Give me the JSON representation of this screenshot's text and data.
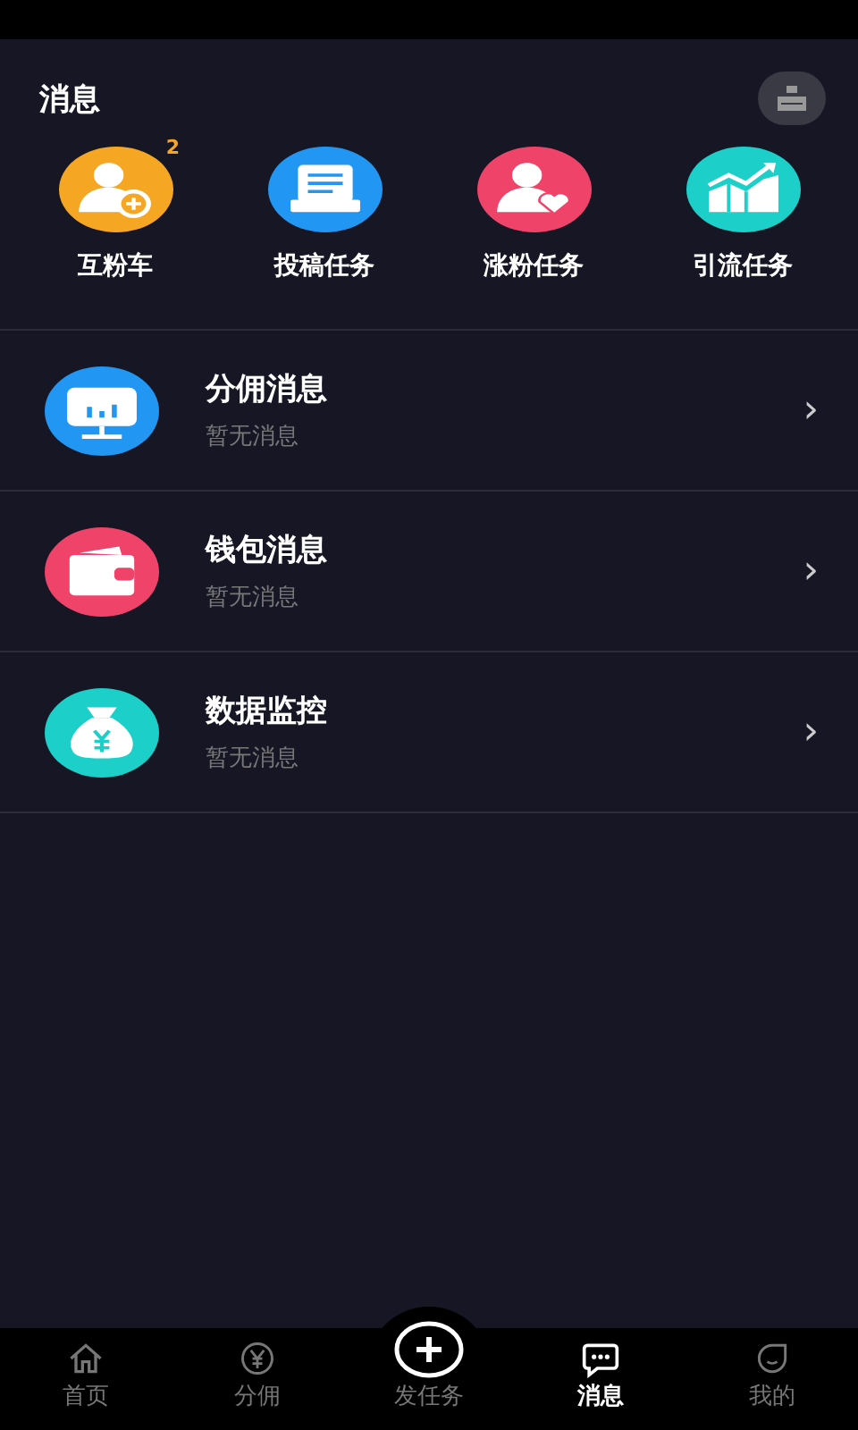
{
  "header": {
    "title": "消息"
  },
  "shortcuts": [
    {
      "label": "互粉车",
      "kind": "person-plus",
      "color": "#f5a623",
      "badge": "2"
    },
    {
      "label": "投稿任务",
      "kind": "document",
      "color": "#2196f3"
    },
    {
      "label": "涨粉任务",
      "kind": "person-heart",
      "color": "#f0436a"
    },
    {
      "label": "引流任务",
      "kind": "chart",
      "color": "#1ccfc9"
    }
  ],
  "messages": [
    {
      "title": "分佣消息",
      "subtitle": "暂无消息",
      "kind": "monitor",
      "color": "#2196f3"
    },
    {
      "title": "钱包消息",
      "subtitle": "暂无消息",
      "kind": "wallet",
      "color": "#f0436a"
    },
    {
      "title": "数据监控",
      "subtitle": "暂无消息",
      "kind": "moneybag",
      "color": "#1ccfc9"
    }
  ],
  "chevron": "›",
  "tabbar": [
    {
      "label": "首页",
      "kind": "home",
      "selected": false
    },
    {
      "label": "分佣",
      "kind": "yen",
      "selected": false
    },
    {
      "label": "发任务",
      "kind": "plus",
      "selected": false
    },
    {
      "label": "消息",
      "kind": "chat",
      "selected": true
    },
    {
      "label": "我的",
      "kind": "face",
      "selected": false
    }
  ]
}
